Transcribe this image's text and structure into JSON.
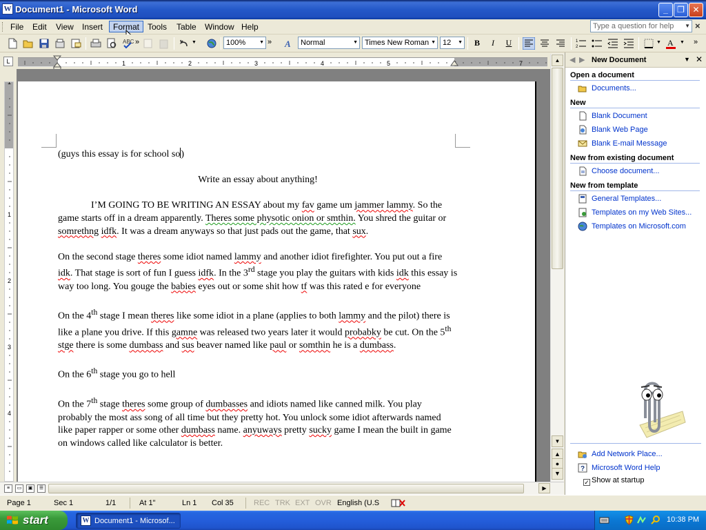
{
  "window": {
    "title": "Document1 - Microsoft Word",
    "controls": {
      "minimize": "_",
      "restore": "❐",
      "close": "✕"
    }
  },
  "menubar": {
    "items": [
      "File",
      "Edit",
      "View",
      "Insert",
      "Format",
      "Tools",
      "Table",
      "Window",
      "Help"
    ],
    "active_item": "Format",
    "ask_question_placeholder": "Type a question for help",
    "doc_close": "×"
  },
  "toolbar": {
    "zoom": "100%",
    "style": "Normal",
    "font": "Times New Roman",
    "font_size": "12",
    "bold": "B",
    "italic": "I",
    "underline": "U",
    "overflow": "»"
  },
  "ruler": {
    "tab_selector": "L",
    "h_labels": [
      "1",
      "1",
      "2",
      "3",
      "4",
      "5",
      "6",
      "7"
    ],
    "v_labels": [
      "1",
      "1",
      "2",
      "3",
      "4"
    ]
  },
  "document": {
    "header_line": "(guys this essay is for  school so",
    "title": "Write an essay about anything!",
    "p1": {
      "a": "I’M GOING TO BE WRITING AN ESSAY about my ",
      "s1": "fav",
      "b": " game um ",
      "s2": "jammer lammy",
      "c": ". So the game starts off in a dream apparently. ",
      "g1": "Theres some physotic onion or smthin.",
      "d": " You shred the guitar or ",
      "s3": "somrethng",
      "e": " ",
      "s4": "idfk",
      "f": ". It was a dream anyways so that just pads out the game, that ",
      "s5": "sux",
      "g": "."
    },
    "p2": {
      "a": "On the second stage ",
      "s1": "theres",
      "b": " some idiot named ",
      "s2": "lammy",
      "c": " and another idiot firefighter.  You put out a fire ",
      "s3": "idk",
      "d": ". That stage is sort of fun I guess ",
      "s4": "idfk",
      "e": ". In the 3",
      "sup": "rd",
      "f": " stage you play the guitars with kids ",
      "s5": "idk",
      "g": " this essay is way too long.  You gouge the ",
      "s6": "babies",
      "h": " eyes out or some shit how ",
      "s7": "tf",
      "i": " was this rated e for everyone"
    },
    "p3": {
      "a": "On the 4",
      "sup1": "th",
      "b": " stage I mean ",
      "s1": "theres",
      "c": " like some idiot in a plane (applies to both ",
      "s2": "lammy",
      "d": " and the pilot) there is like a plane you drive. If this ",
      "s3": "gamne",
      "e": " was released two years later it would ",
      "s4": "probabky",
      "f": " be cut. On the 5",
      "sup2": "th",
      "g": " ",
      "s5": "stge",
      "h": " there is some ",
      "s6": "dumbass",
      "i": " and ",
      "s7": "sus",
      "j": " beaver named like ",
      "s8": "paul",
      "k": " or ",
      "s9": "somthin",
      "l": " he is a ",
      "s10": "dumbass",
      "m": "."
    },
    "p4": {
      "a": "On the 6",
      "sup": "th",
      "b": " stage you go to hell"
    },
    "p5": {
      "a": "On the 7",
      "sup": "th",
      "b": " stage ",
      "s1": "theres",
      "c": " some group of ",
      "s2": "dumbasses",
      "d": " and idiots named like canned milk.  You play probably the most ass song of all time but they pretty hot. You unlock some idiot afterwards named like paper rapper or some other ",
      "s3": "dumbass",
      "e": " name. ",
      "s4": "anyuways",
      "f": " pretty ",
      "s5": "sucky",
      "g": " game I mean the built in game on windows called like calculator is better."
    }
  },
  "taskpane": {
    "title": "New Document",
    "sections": {
      "open": "Open a document",
      "new": "New",
      "existing": "New from existing document",
      "template": "New from template"
    },
    "links": {
      "documents": "Documents...",
      "blank_document": "Blank Document",
      "blank_web_page": "Blank Web Page",
      "blank_email": "Blank E-mail Message",
      "choose_document": "Choose document...",
      "general_templates": "General Templates...",
      "templates_web": "Templates on my Web Sites...",
      "templates_ms": "Templates on Microsoft.com",
      "add_network_place": "Add Network Place...",
      "word_help": "Microsoft Word Help"
    },
    "show_at_startup": "Show at startup",
    "show_at_startup_checked": true
  },
  "statusbar": {
    "page": "Page  1",
    "sec": "Sec  1",
    "pages": "1/1",
    "at": "At  1\"",
    "ln": "Ln  1",
    "col": "Col  35",
    "rec": "REC",
    "trk": "TRK",
    "ext": "EXT",
    "ovr": "OVR",
    "language": "English (U.S"
  },
  "taskbar": {
    "start": "start",
    "task_button": "Document1 - Microsof...",
    "clock": "10:38 PM"
  },
  "colors": {
    "titlebar": "#2458c8",
    "spelling_underline": "#e00000",
    "grammar_underline": "#1a9a1a",
    "link": "#0033cc",
    "start_button": "#3a9a3a",
    "taskbar": "#245edb"
  }
}
